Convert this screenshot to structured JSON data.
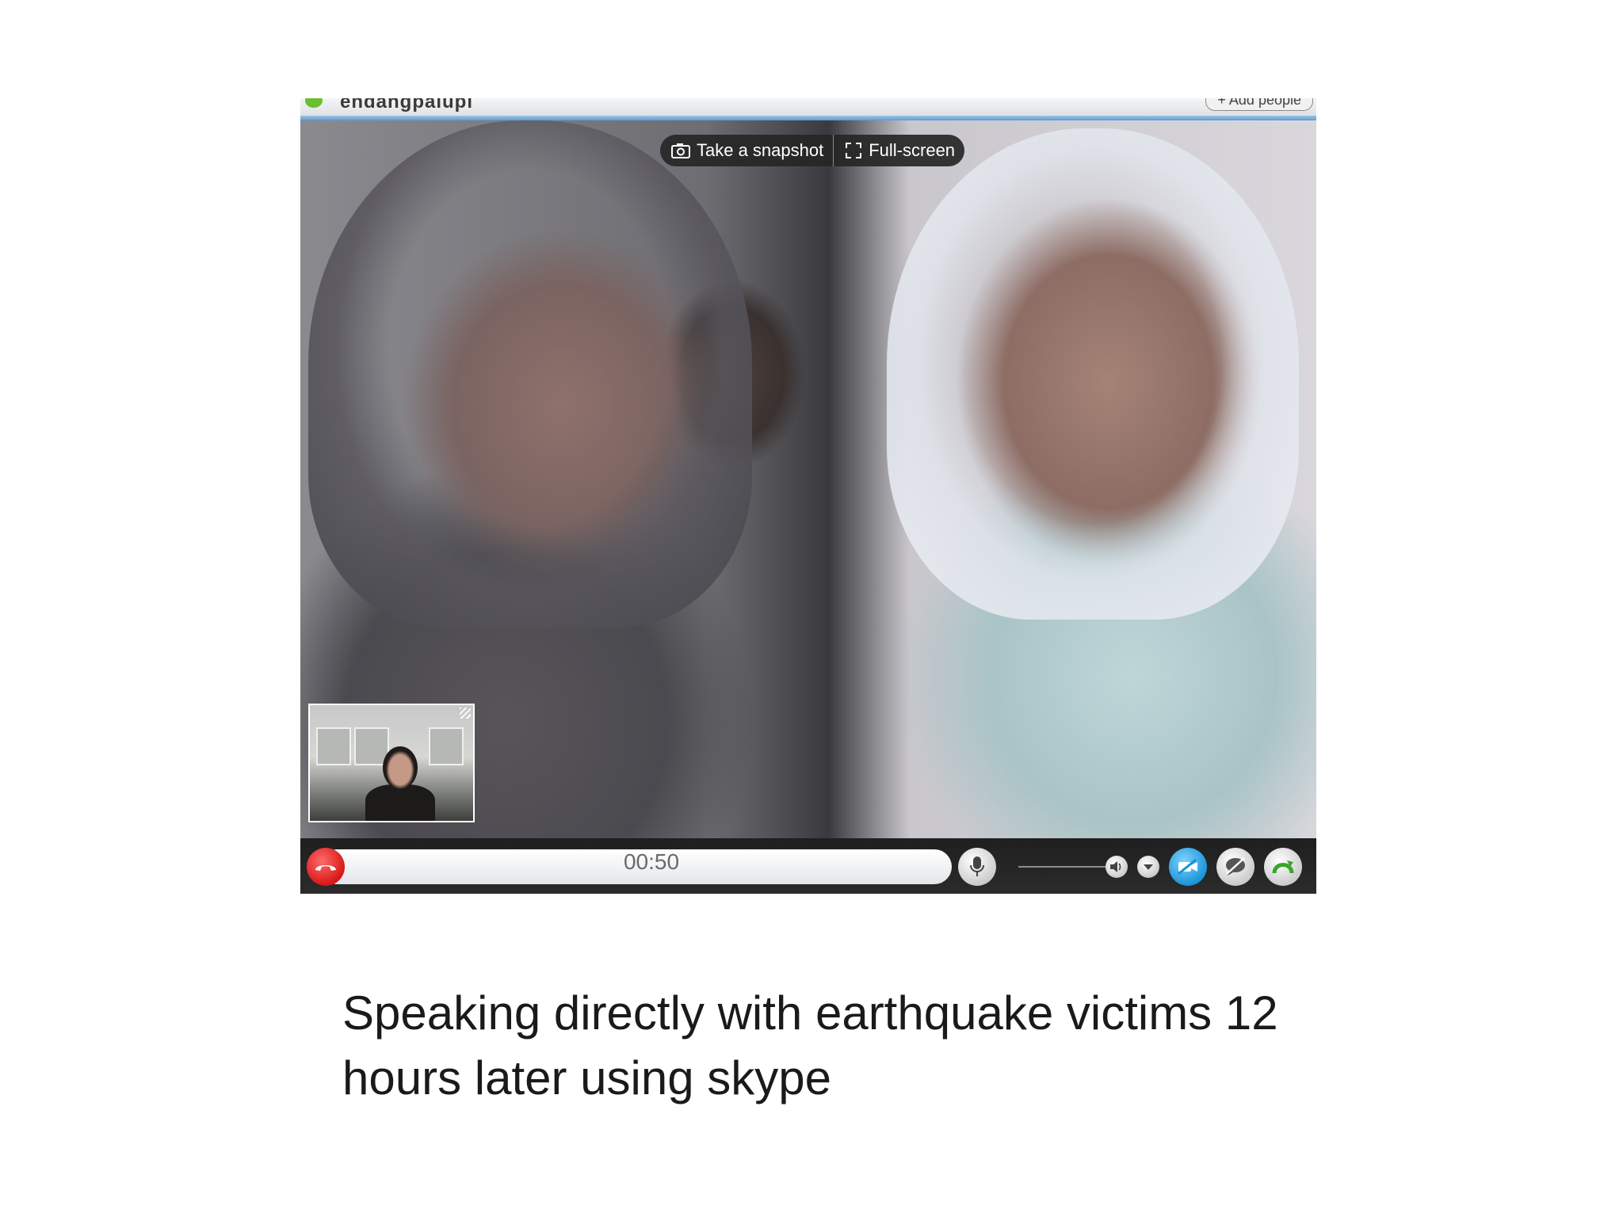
{
  "window": {
    "contact_name": "endangpalupi",
    "add_people_label": "+ Add people"
  },
  "overlay": {
    "snapshot_label": "Take a snapshot",
    "fullscreen_label": "Full-screen"
  },
  "call": {
    "duration": "00:50"
  },
  "caption": {
    "line1": "Speaking directly with earthquake victims 12",
    "line2": "hours later using skype"
  },
  "colors": {
    "end_call": "#d81818",
    "video_toggle": "#1592d6",
    "status_online": "#6bbf2e"
  }
}
